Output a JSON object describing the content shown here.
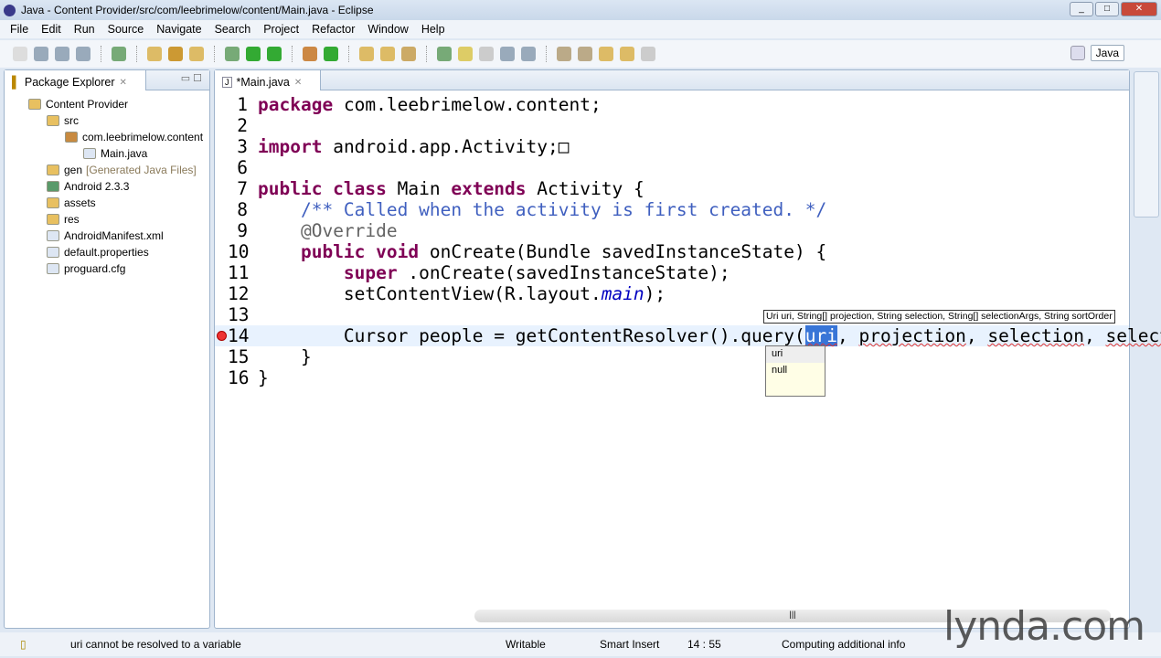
{
  "window": {
    "title": "Java - Content Provider/src/com/leebrimelow/content/Main.java - Eclipse"
  },
  "menu": [
    "File",
    "Edit",
    "Run",
    "Source",
    "Navigate",
    "Search",
    "Project",
    "Refactor",
    "Window",
    "Help"
  ],
  "perspective": {
    "label": "Java"
  },
  "explorer": {
    "title": "Package Explorer",
    "nodes": [
      {
        "label": "Content Provider",
        "level": 0,
        "icon": "project-icon",
        "color": "#e8c060"
      },
      {
        "label": "src",
        "level": 1,
        "icon": "source-folder-icon",
        "color": "#e8c060"
      },
      {
        "label": "com.leebrimelow.content",
        "level": 2,
        "icon": "package-icon",
        "color": "#c88a40"
      },
      {
        "label": "Main.java",
        "level": 3,
        "icon": "java-file-icon",
        "color": "#dde6f3"
      },
      {
        "label": "gen",
        "extra": "[Generated Java Files]",
        "level": 1,
        "icon": "source-folder-icon",
        "color": "#e8c060"
      },
      {
        "label": "Android 2.3.3",
        "level": 1,
        "icon": "library-icon",
        "color": "#5a9a6a"
      },
      {
        "label": "assets",
        "level": 1,
        "icon": "folder-icon",
        "color": "#e8c060"
      },
      {
        "label": "res",
        "level": 1,
        "icon": "folder-icon",
        "color": "#e8c060"
      },
      {
        "label": "AndroidManifest.xml",
        "level": 1,
        "icon": "xml-file-icon",
        "color": "#dde6f3"
      },
      {
        "label": "default.properties",
        "level": 1,
        "icon": "file-icon",
        "color": "#dde6f3"
      },
      {
        "label": "proguard.cfg",
        "level": 1,
        "icon": "file-icon",
        "color": "#dde6f3"
      }
    ]
  },
  "editor": {
    "tab": "*Main.java",
    "lines": [
      {
        "n": "1",
        "t": [
          [
            "kw",
            "package"
          ],
          [
            "",
            "com.leebrimelow.content;"
          ]
        ]
      },
      {
        "n": "2",
        "t": []
      },
      {
        "n": "3",
        "t": [
          [
            "kw",
            "import"
          ],
          [
            "",
            "android.app.Activity;□"
          ]
        ]
      },
      {
        "n": "6",
        "t": []
      },
      {
        "n": "7",
        "t": [
          [
            "kw",
            "public class"
          ],
          [
            "",
            "Main "
          ],
          [
            "kw",
            "extends"
          ],
          [
            "",
            "Activity {"
          ]
        ]
      },
      {
        "n": "8",
        "t": [
          [
            "",
            "    "
          ],
          [
            "cm",
            "/** Called when the activity is first created. */"
          ]
        ]
      },
      {
        "n": "9",
        "t": [
          [
            "",
            "    "
          ],
          [
            "an",
            "@Override"
          ]
        ]
      },
      {
        "n": "10",
        "t": [
          [
            "",
            "    "
          ],
          [
            "kw",
            "public void"
          ],
          [
            "",
            "onCreate(Bundle savedInstanceState) {"
          ]
        ]
      },
      {
        "n": "11",
        "t": [
          [
            "",
            "        "
          ],
          [
            "kw",
            "super"
          ],
          [
            "",
            ".onCreate(savedInstanceState);"
          ]
        ]
      },
      {
        "n": "12",
        "t": [
          [
            "",
            "        setContentView(R.layout."
          ],
          [
            "it",
            "main"
          ],
          [
            "",
            ");"
          ]
        ]
      },
      {
        "n": "13",
        "t": []
      },
      {
        "n": "14",
        "t": [
          [
            "",
            "        Cursor people = getContentResolver().query("
          ],
          [
            "sel sq",
            "uri"
          ],
          [
            "",
            ", "
          ],
          [
            "sq",
            "projection"
          ],
          [
            "",
            ", "
          ],
          [
            "sq",
            "selection"
          ],
          [
            "",
            ", "
          ],
          [
            "sq",
            "select"
          ]
        ],
        "cur": true
      },
      {
        "n": "15",
        "t": [
          [
            "",
            "    }"
          ]
        ]
      },
      {
        "n": "16",
        "t": [
          [
            "",
            "}"
          ]
        ]
      }
    ]
  },
  "hint": "Uri uri, String[] projection, String selection, String[] selectionArgs, String sortOrder",
  "proposals": [
    "uri",
    "null"
  ],
  "status": {
    "message": "uri cannot be resolved to a variable",
    "writable": "Writable",
    "insert": "Smart Insert",
    "position": "14 : 55",
    "progress": "Computing additional info"
  },
  "watermark": "lynda.com"
}
